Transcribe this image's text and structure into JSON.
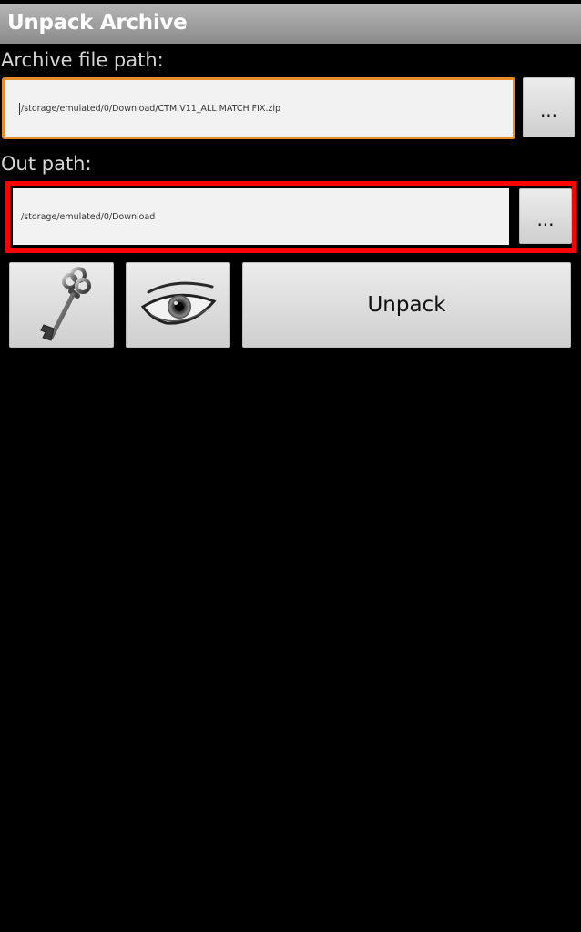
{
  "window": {
    "title": "Unpack Archive"
  },
  "archive": {
    "label": "Archive file path:",
    "path": "/storage/emulated/0/Download/CTM V11_ALL MATCH FIX.zip",
    "browse_label": "..."
  },
  "output": {
    "label": "Out path:",
    "path": "/storage/emulated/0/Download",
    "browse_label": "..."
  },
  "actions": {
    "password_icon": "key-icon",
    "preview_icon": "eye-icon",
    "unpack_label": "Unpack"
  },
  "colors": {
    "focus_border": "#e98d2a",
    "highlight_border": "#ff0000",
    "background": "#000000"
  }
}
